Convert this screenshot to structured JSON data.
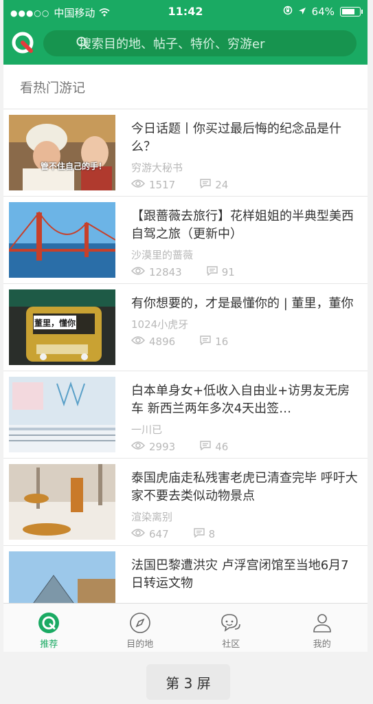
{
  "status_bar": {
    "carrier": "中国移动",
    "time": "11:42",
    "battery_percent": "64%",
    "battery_level": 0.64
  },
  "search": {
    "placeholder": "搜索目的地、帖子、特价、穷游er"
  },
  "section": {
    "title": "看热门游记"
  },
  "articles": [
    {
      "title": "今日话题丨你买过最后悔的纪念品是什么？",
      "author": "穷游大秘书",
      "views": "1517",
      "comments": "24",
      "thumb_caption": "管不住自己的手！"
    },
    {
      "title": "【跟蔷薇去旅行】花样姐姐的半典型美西自驾之旅（更新中）",
      "author": "沙漠里的蔷薇",
      "views": "12843",
      "comments": "91"
    },
    {
      "title": "有你想要的，才是最懂你的 | 董里，董你",
      "author": "1024小虎牙",
      "views": "4896",
      "comments": "16",
      "thumb_caption": "董里，懂你"
    },
    {
      "title": "白本单身女+低收入自由业+访男友无房车 新西兰两年多次4天出签…",
      "author": "一川已",
      "views": "2993",
      "comments": "46"
    },
    {
      "title": "泰国虎庙走私残害老虎已清查完毕 呼吁大家不要去类似动物景点",
      "author": "渲染离别",
      "views": "647",
      "comments": "8"
    },
    {
      "title": "法国巴黎遭洪灾 卢浮宫闭馆至当地6月7日转运文物",
      "author": "",
      "views": "",
      "comments": ""
    }
  ],
  "tabs": [
    {
      "label": "推荐",
      "icon": "recommend-icon",
      "active": true
    },
    {
      "label": "目的地",
      "icon": "compass-icon",
      "active": false
    },
    {
      "label": "社区",
      "icon": "community-icon",
      "active": false
    },
    {
      "label": "我的",
      "icon": "profile-icon",
      "active": false
    }
  ],
  "page_button": {
    "label": "第 3 屏"
  },
  "colors": {
    "brand_green": "#1aaa63",
    "search_bg": "#17944f"
  }
}
